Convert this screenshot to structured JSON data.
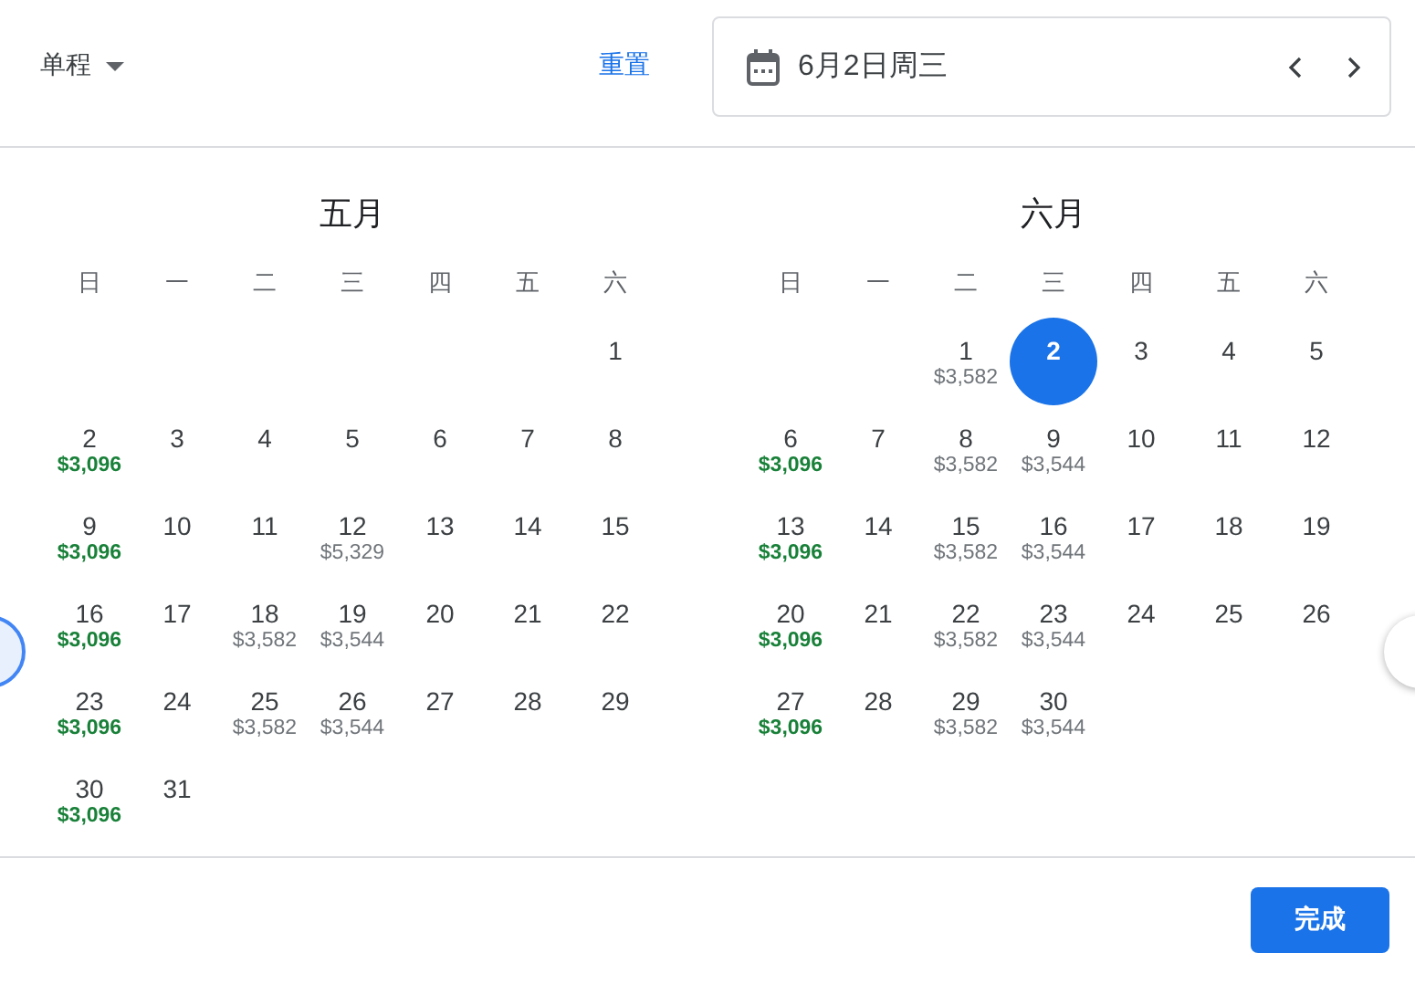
{
  "header": {
    "trip_type": "单程",
    "reset": "重置",
    "date_field": {
      "value": "6月2日周三"
    }
  },
  "months": [
    {
      "title": "五月",
      "weekdays": [
        "日",
        "一",
        "二",
        "三",
        "四",
        "五",
        "六"
      ],
      "weeks": [
        {
          "kind": "first",
          "days": [
            {
              "day": "1",
              "selected": false
            }
          ]
        },
        {
          "kind": "full",
          "days": [
            {
              "day": "2",
              "price": "$3,096",
              "cheap": true,
              "selected": false
            },
            {
              "day": "3",
              "selected": false
            },
            {
              "day": "4",
              "selected": false
            },
            {
              "day": "5",
              "selected": false
            },
            {
              "day": "6",
              "selected": false
            },
            {
              "day": "7",
              "selected": false
            },
            {
              "day": "8",
              "selected": false
            }
          ]
        },
        {
          "kind": "full",
          "days": [
            {
              "day": "9",
              "price": "$3,096",
              "cheap": true,
              "selected": false
            },
            {
              "day": "10",
              "selected": false
            },
            {
              "day": "11",
              "selected": false
            },
            {
              "day": "12",
              "price": "$5,329",
              "cheap": false,
              "selected": false
            },
            {
              "day": "13",
              "selected": false
            },
            {
              "day": "14",
              "selected": false
            },
            {
              "day": "15",
              "selected": false
            }
          ]
        },
        {
          "kind": "full",
          "days": [
            {
              "day": "16",
              "price": "$3,096",
              "cheap": true,
              "selected": false
            },
            {
              "day": "17",
              "selected": false
            },
            {
              "day": "18",
              "price": "$3,582",
              "cheap": false,
              "selected": false
            },
            {
              "day": "19",
              "price": "$3,544",
              "cheap": false,
              "selected": false
            },
            {
              "day": "20",
              "selected": false
            },
            {
              "day": "21",
              "selected": false
            },
            {
              "day": "22",
              "selected": false
            }
          ]
        },
        {
          "kind": "full",
          "days": [
            {
              "day": "23",
              "price": "$3,096",
              "cheap": true,
              "selected": false
            },
            {
              "day": "24",
              "selected": false
            },
            {
              "day": "25",
              "price": "$3,582",
              "cheap": false,
              "selected": false
            },
            {
              "day": "26",
              "price": "$3,544",
              "cheap": false,
              "selected": false
            },
            {
              "day": "27",
              "selected": false
            },
            {
              "day": "28",
              "selected": false
            },
            {
              "day": "29",
              "selected": false
            }
          ]
        },
        {
          "kind": "last",
          "days": [
            {
              "day": "30",
              "price": "$3,096",
              "cheap": true,
              "selected": false
            },
            {
              "day": "31",
              "selected": false
            }
          ]
        }
      ]
    },
    {
      "title": "六月",
      "weekdays": [
        "日",
        "一",
        "二",
        "三",
        "四",
        "五",
        "六"
      ],
      "weeks": [
        {
          "kind": "first",
          "days": [
            {
              "day": "1",
              "price": "$3,582",
              "cheap": false,
              "selected": false
            },
            {
              "day": "2",
              "selected": true
            },
            {
              "day": "3",
              "selected": false
            },
            {
              "day": "4",
              "selected": false
            },
            {
              "day": "5",
              "selected": false
            }
          ]
        },
        {
          "kind": "full",
          "days": [
            {
              "day": "6",
              "price": "$3,096",
              "cheap": true,
              "selected": false
            },
            {
              "day": "7",
              "selected": false
            },
            {
              "day": "8",
              "price": "$3,582",
              "cheap": false,
              "selected": false
            },
            {
              "day": "9",
              "price": "$3,544",
              "cheap": false,
              "selected": false
            },
            {
              "day": "10",
              "selected": false
            },
            {
              "day": "11",
              "selected": false
            },
            {
              "day": "12",
              "selected": false
            }
          ]
        },
        {
          "kind": "full",
          "days": [
            {
              "day": "13",
              "price": "$3,096",
              "cheap": true,
              "selected": false
            },
            {
              "day": "14",
              "selected": false
            },
            {
              "day": "15",
              "price": "$3,582",
              "cheap": false,
              "selected": false
            },
            {
              "day": "16",
              "price": "$3,544",
              "cheap": false,
              "selected": false
            },
            {
              "day": "17",
              "selected": false
            },
            {
              "day": "18",
              "selected": false
            },
            {
              "day": "19",
              "selected": false
            }
          ]
        },
        {
          "kind": "full",
          "days": [
            {
              "day": "20",
              "price": "$3,096",
              "cheap": true,
              "selected": false
            },
            {
              "day": "21",
              "selected": false
            },
            {
              "day": "22",
              "price": "$3,582",
              "cheap": false,
              "selected": false
            },
            {
              "day": "23",
              "price": "$3,544",
              "cheap": false,
              "selected": false
            },
            {
              "day": "24",
              "selected": false
            },
            {
              "day": "25",
              "selected": false
            },
            {
              "day": "26",
              "selected": false
            }
          ]
        },
        {
          "kind": "last",
          "days": [
            {
              "day": "27",
              "price": "$3,096",
              "cheap": true,
              "selected": false
            },
            {
              "day": "28",
              "selected": false
            },
            {
              "day": "29",
              "price": "$3,582",
              "cheap": false,
              "selected": false
            },
            {
              "day": "30",
              "price": "$3,544",
              "cheap": false,
              "selected": false
            }
          ]
        }
      ]
    }
  ],
  "footer": {
    "done": "完成"
  }
}
